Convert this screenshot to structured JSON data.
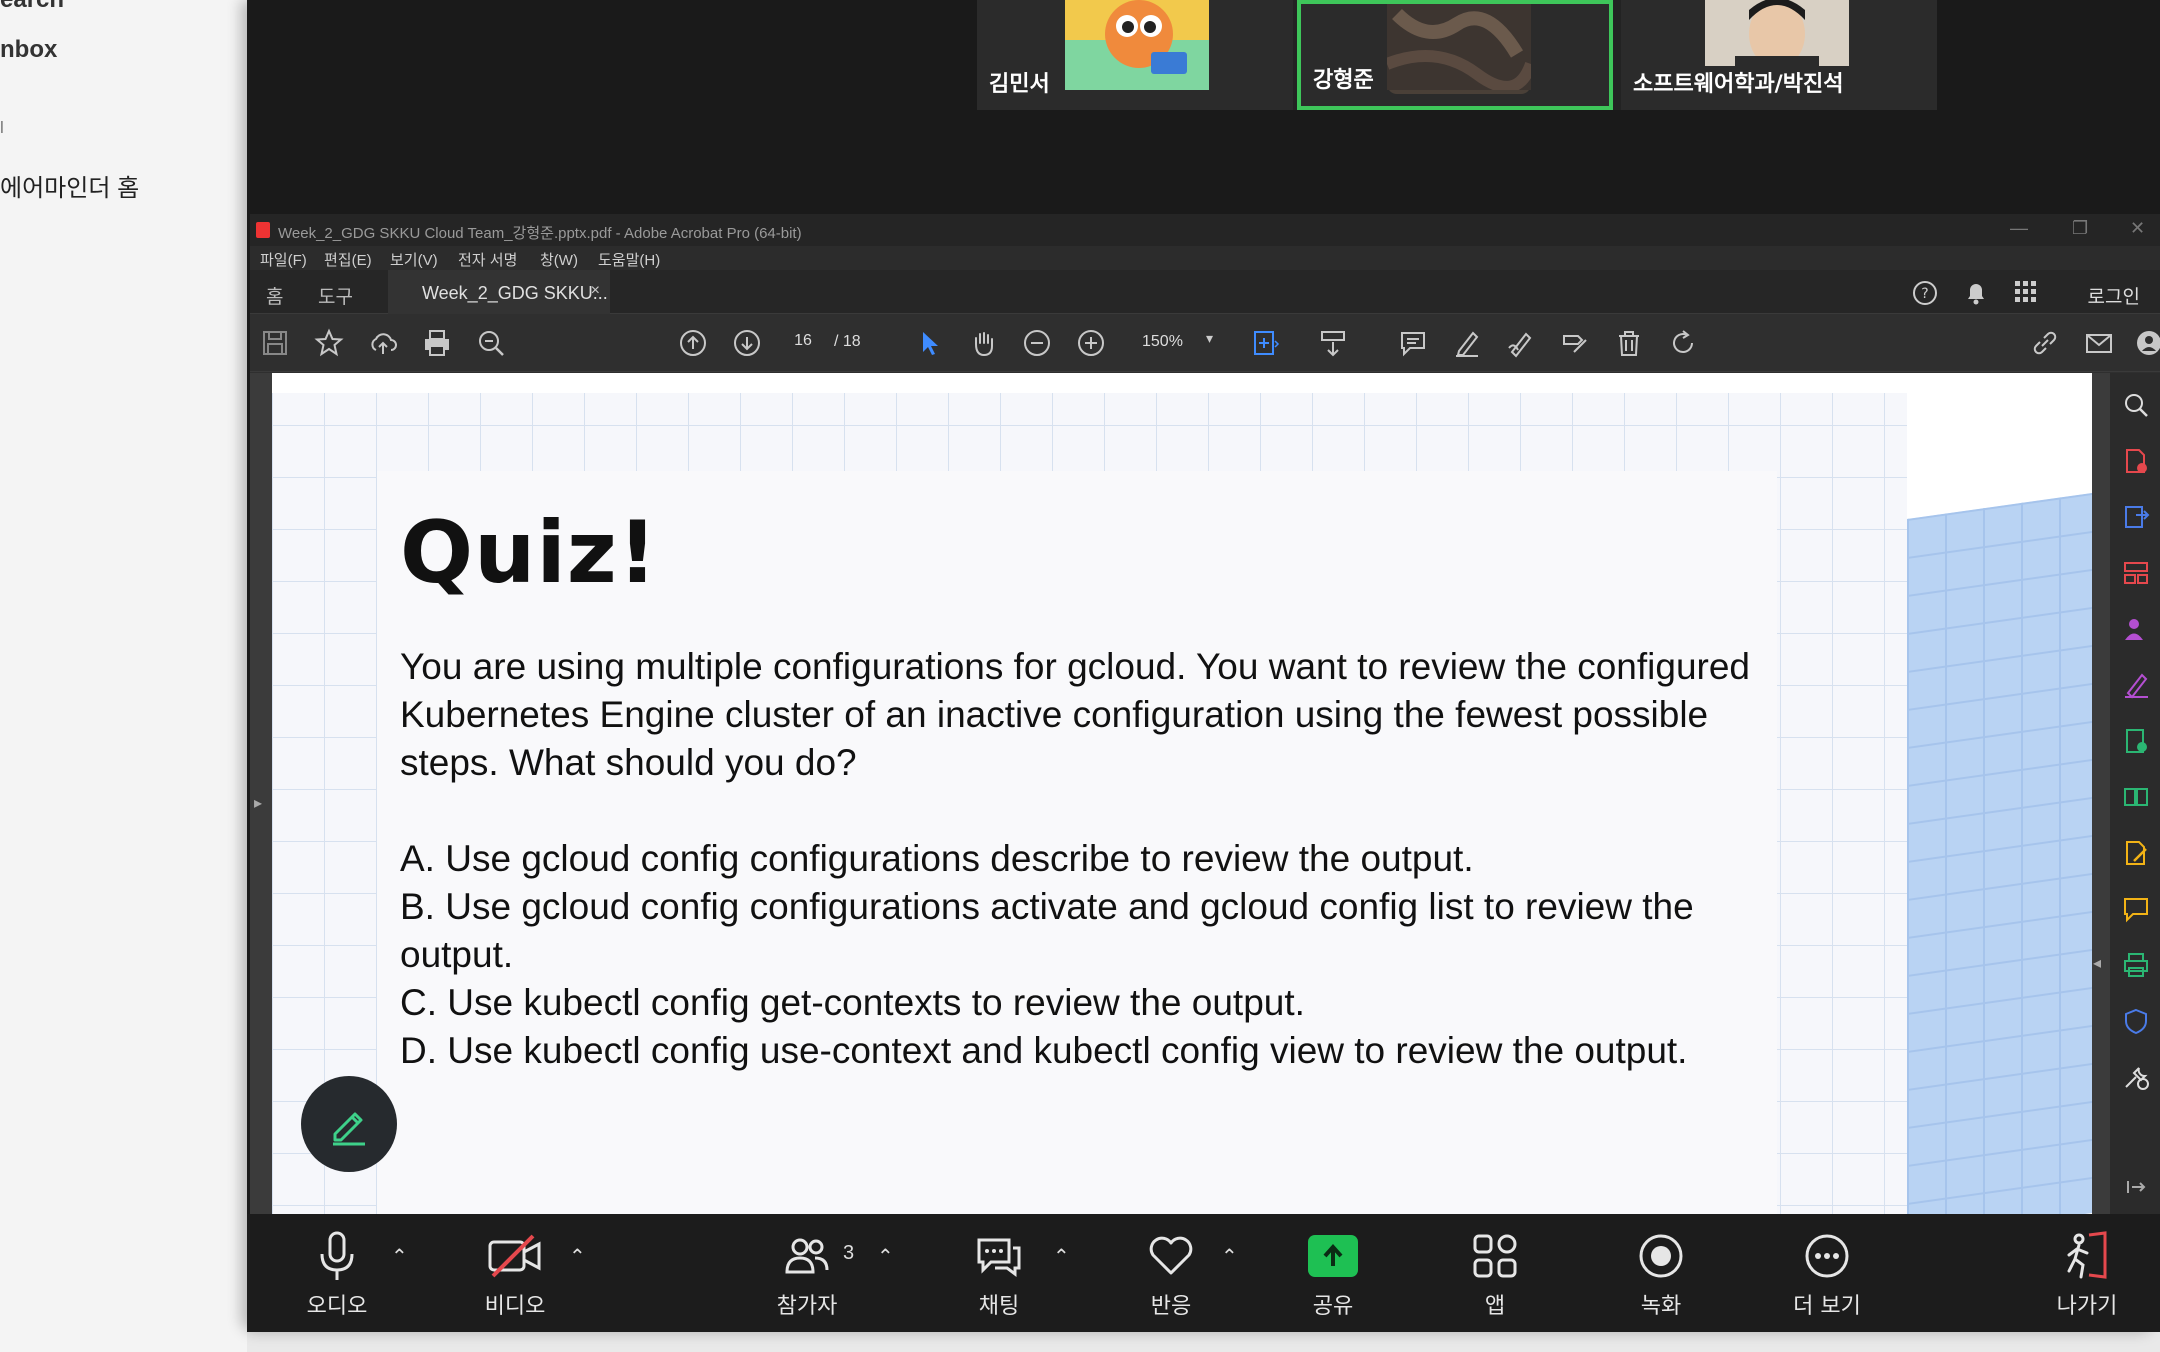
{
  "background_app": {
    "items": [
      "earch",
      "nbox",
      "l",
      "에어마인더 홈"
    ]
  },
  "gallery": {
    "participants": [
      {
        "name": "김민서"
      },
      {
        "name": "강형준"
      },
      {
        "name": "소프트웨어학과/박진석"
      }
    ]
  },
  "acrobat": {
    "window_title": "Week_2_GDG SKKU Cloud Team_강형준.pptx.pdf - Adobe Acrobat Pro (64-bit)",
    "menu": [
      "파일(F)",
      "편집(E)",
      "보기(V)",
      "전자 서명",
      "창(W)",
      "도움말(H)"
    ],
    "tabs": {
      "home": "홈",
      "tools": "도구",
      "document": "Week_2_GDG SKKU...",
      "close": "×"
    },
    "login": "로그인",
    "page_current": "16",
    "page_total": "/ 18",
    "zoom": "150%"
  },
  "slide": {
    "title": "Quiz!",
    "question": "You are using multiple configurations for gcloud. You want to review the configured Kubernetes Engine cluster of an inactive configuration using the fewest possible steps. What should you do?",
    "options": [
      "A. Use gcloud config configurations describe to review the output.",
      "B. Use gcloud config configurations activate and gcloud config list to review the output.",
      "C. Use kubectl config get-contexts to review the output.",
      "D. Use kubectl config use-context and kubectl config view to review the output."
    ]
  },
  "zoom_bar": {
    "audio": "오디오",
    "video": "비디오",
    "participants": "참가자",
    "participants_count": "3",
    "chat": "채팅",
    "reactions": "반응",
    "share": "공유",
    "apps": "앱",
    "record": "녹화",
    "more": "더 보기",
    "leave": "나가기"
  },
  "colors": {
    "share_green": "#1ec053",
    "active_speaker": "#3ec65a",
    "video_off_red": "#e5484d"
  }
}
